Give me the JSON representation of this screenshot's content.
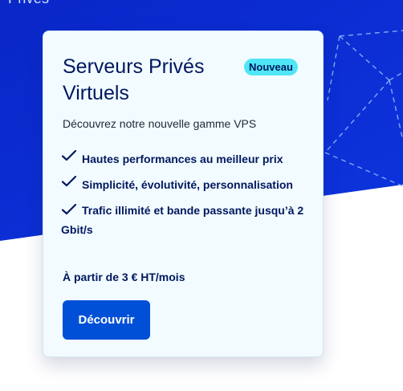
{
  "hero": {
    "top_text": "Privés"
  },
  "card": {
    "title": "Serveurs Privés Virtuels",
    "badge": "Nouveau",
    "subtitle": "Découvrez notre nouvelle gamme VPS",
    "features": [
      "Hautes performances au meilleur prix",
      "Simplicité, évolutivité, personnalisation",
      "Trafic illimité et bande passante jusqu’à 2 Gbit/s"
    ],
    "price": "À partir de 3 € HT/mois",
    "cta_label": "Découvrir"
  },
  "colors": {
    "hero_blue": "#0b2ad6",
    "card_background": "#f2fbff",
    "badge": "#4fe6f6",
    "title": "#00185e",
    "button": "#0050d7"
  },
  "icons": {
    "feature": "checkmark-icon"
  }
}
